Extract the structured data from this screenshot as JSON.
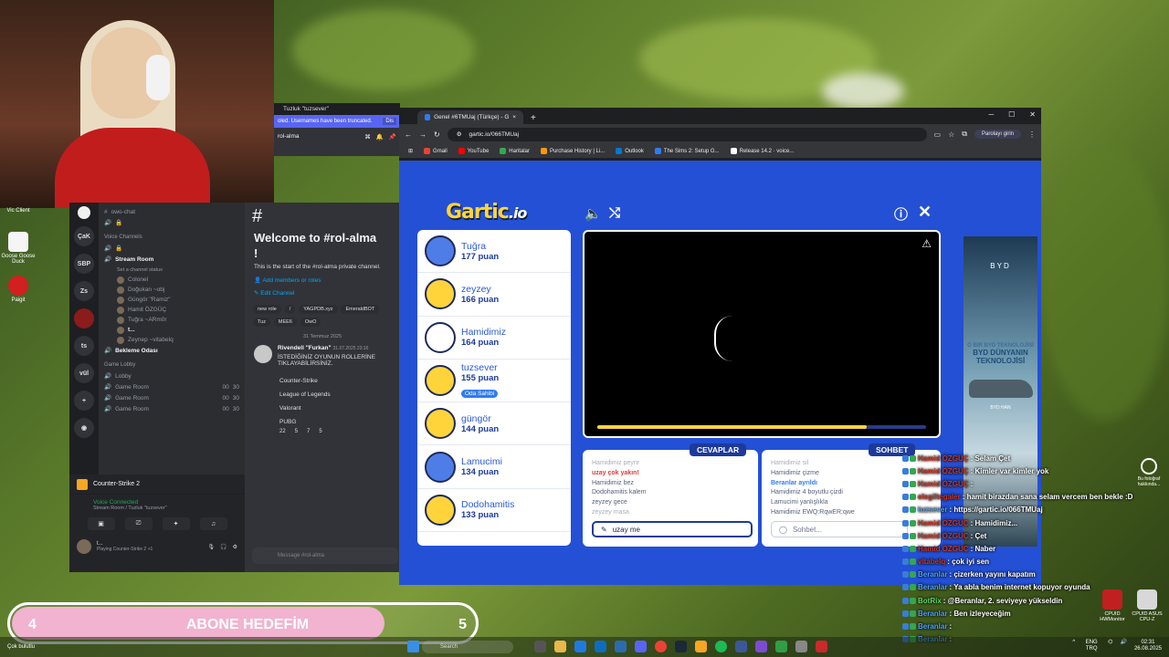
{
  "webcam": {
    "label": "Webcam"
  },
  "desktop_icons": [
    {
      "label": "Vic Client"
    },
    {
      "label": "Goose Goose Duck"
    },
    {
      "label": "Paigit"
    }
  ],
  "discord": {
    "servers": [
      "ÇaK",
      "SBP",
      "Zs",
      "ts",
      "vül"
    ],
    "top_channel": "owo-chat",
    "voice_category": "Voice Channels",
    "stream_room": "Stream Room",
    "stream_status": "Set a channel status",
    "members": [
      "Colonel",
      "Doğukan ~obj",
      "Güngör \"Ramiz\"",
      "Hamit ÖZGÜÇ",
      "Tuğra ~ARm0r",
      "t...",
      "Zeynep ~vitabelq"
    ],
    "bekleme": "Bekleme Odası",
    "game_lobby_cat": "Game Lobby",
    "lobby": "Lobby",
    "game_rooms": [
      "Game Room",
      "Game Room",
      "Game Room"
    ],
    "game_room_counts": [
      "00",
      "00",
      "00"
    ],
    "game_room_limits": [
      "30",
      "30",
      "30"
    ],
    "now_playing": "Counter-Strike 2",
    "voice_connected": "Voice Connected",
    "voice_location": "Stream Room / Tuzluk \"tuzsever\"",
    "user_activity": "Playing Counter-Strike 2 +1",
    "user_short": "t..."
  },
  "chat": {
    "title": "Tuzluk \"tuzsever\"",
    "banner": "oled. Usernames have been truncated.",
    "banner_btn": "Dis",
    "channel": "rol-alma",
    "welcome": "Welcome to #rol-alma",
    "welcome_suffix": "!",
    "intro": "This is the start of the #rol-alma private channel.",
    "add_members": "Add members or roles",
    "edit_channel": "Edit Channel",
    "pills": [
      "new role",
      "/",
      "YAGPDB.xyz",
      "EmeraldBOT",
      "Tuz",
      "MEE6",
      "OwO"
    ],
    "date": "31 Temmuz 2025",
    "author": "Rivendell \"Furkan\"",
    "timestamp": "31.07.2025 23:16",
    "message": "İSTEDİĞİNİZ OYUNUN ROLLERİNE TIKLAYABİLİRSİNİZ.",
    "games": [
      "Counter-Strike",
      "League of Legends",
      "Valorant",
      "PUBG"
    ],
    "reactions": [
      "22",
      "5",
      "7",
      "5"
    ],
    "input_placeholder": "Message #rol-alma"
  },
  "browser": {
    "tab_title": "Genel #6TMUaj (Türkçe) - Gartic",
    "url": "gartic.io/066TMUaj",
    "password_btn": "Parolayı girin",
    "bookmarks": [
      "Gmail",
      "YouTube",
      "Haritalar",
      "Purchase History | Li...",
      "Outlook",
      "The Sims 2: Setup G...",
      "Release 14.2 · voice..."
    ],
    "bookmark_colors": [
      "#ea4335",
      "#ff0000",
      "#34a853",
      "#ff9900",
      "#0078d4",
      "#2f7bf0",
      "#ffffff"
    ]
  },
  "gartic": {
    "logo": "Gartic",
    "logo_suffix": ".io",
    "players": [
      {
        "name": "Tuğra",
        "points": "177 puan"
      },
      {
        "name": "zeyzey",
        "points": "166 puan"
      },
      {
        "name": "Hamidimiz",
        "points": "164 puan"
      },
      {
        "name": "tuzsever",
        "points": "155 puan",
        "owner": "Oda Sahibi"
      },
      {
        "name": "güngör",
        "points": "144 puan"
      },
      {
        "name": "Lamucimi",
        "points": "134 puan"
      },
      {
        "name": "Dodohamitis",
        "points": "133 puan"
      }
    ],
    "progress": 0.82,
    "answers_label": "CEVAPLAR",
    "chat_label": "SOHBET",
    "answers": [
      {
        "text": "Hamidimiz peyrir",
        "style": "muted"
      },
      {
        "text": "uzay çok yakın!",
        "style": "hl"
      },
      {
        "text": "Hamidimiz bez",
        "style": ""
      },
      {
        "text": "Dodohamitis kalem",
        "style": ""
      },
      {
        "text": "zeyzey gece",
        "style": ""
      },
      {
        "text": "zeyzey masa",
        "style": "muted"
      }
    ],
    "chat": [
      {
        "text": "Hamidimiz sil",
        "style": "muted"
      },
      {
        "text": "Hamidimiz çizme",
        "style": ""
      },
      {
        "text": "Beranlar ayrıldı",
        "style": "hb"
      },
      {
        "text": "Hamidimiz 4 boyutlu çizdi",
        "style": ""
      },
      {
        "text": "Lamucimi yanlışlıkla",
        "style": ""
      },
      {
        "text": "Hamidimiz EWQ:RqwER:qwe",
        "style": ""
      }
    ],
    "answer_input": "uzay me",
    "chat_placeholder": "Sohbet...",
    "ad_brand": "BYD",
    "ad_line1": "O BIR BYD TEKNOLOJİSİ",
    "ad_line2": "BYD DÜNYANIN TEKNOLOJİSİ",
    "ad_model": "BYD HAN"
  },
  "overlay_chat": [
    {
      "user": "Hamid ÖZGÜÇ",
      "msg": ": Selam Çet",
      "color": "red"
    },
    {
      "user": "Hamid ÖZGÜÇ",
      "msg": ": Kimler var kimler yok",
      "color": "red"
    },
    {
      "user": "Hamid ÖZGÜÇ",
      "msg": ":",
      "color": "red"
    },
    {
      "user": "elegiltegaler",
      "msg": ": hamit birazdan sana selam vercem ben bekle :D",
      "color": "red"
    },
    {
      "user": "tuzsever",
      "msg": ": https://gartic.io/066TMUaj",
      "color": "blue"
    },
    {
      "user": "Hamid ÖZGÜÇ",
      "msg": ": Hamidimiz...",
      "color": "red"
    },
    {
      "user": "Hamid ÖZGÜÇ",
      "msg": ": Çet",
      "color": "red"
    },
    {
      "user": "Hamid ÖZGÜÇ",
      "msg": ": Naber",
      "color": "red"
    },
    {
      "user": "vitabelq",
      "msg": ": çok iyi sen",
      "color": "red"
    },
    {
      "user": "Beranlar",
      "msg": ": çizerken yayını kapatım",
      "color": "blue"
    },
    {
      "user": "Beranlar",
      "msg": ": Ya abla benim internet kopuyor oyunda",
      "color": "blue"
    },
    {
      "user": "BotRix",
      "msg": ": @Beranlar, 2. seviyeye yükseldin",
      "color": "green"
    },
    {
      "user": "Beranlar",
      "msg": ": Ben izleyeceğim",
      "color": "blue"
    },
    {
      "user": "Beranlar",
      "msg": ":",
      "color": "blue"
    },
    {
      "user": "Beranlar",
      "msg": ":",
      "color": "blue"
    }
  ],
  "abone": {
    "start": "4",
    "title": "ABONE HEDEFİM",
    "end": "5",
    "progress": 0.8
  },
  "taskbar": {
    "weather": "Çok bulutlu",
    "search": "Search",
    "lang": "ENG TRQ",
    "time": "02:31",
    "date": "26.08.2025",
    "apps": [
      "CPUID HWMonitor",
      "CPUID ASUS CPU-Z"
    ]
  },
  "side_icon": "Bu fotoğraf hakkında..."
}
